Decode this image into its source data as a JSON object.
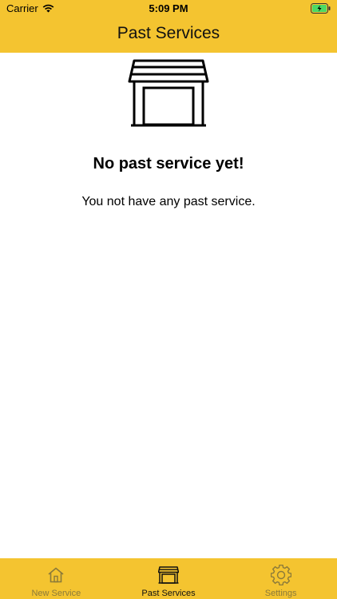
{
  "status_bar": {
    "carrier": "Carrier",
    "time": "5:09 PM"
  },
  "nav": {
    "title": "Past Services"
  },
  "empty_state": {
    "icon": "garage-icon",
    "title": "No past service yet!",
    "description": "You not have any past service."
  },
  "tabs": [
    {
      "label": "New Service",
      "icon": "home-icon",
      "active": false
    },
    {
      "label": "Past Services",
      "icon": "garage-icon",
      "active": true
    },
    {
      "label": "Settings",
      "icon": "gear-icon",
      "active": false
    }
  ],
  "colors": {
    "accent": "#f4c430",
    "inactive_tab": "#8b7a3a",
    "battery": "#4cd964"
  }
}
